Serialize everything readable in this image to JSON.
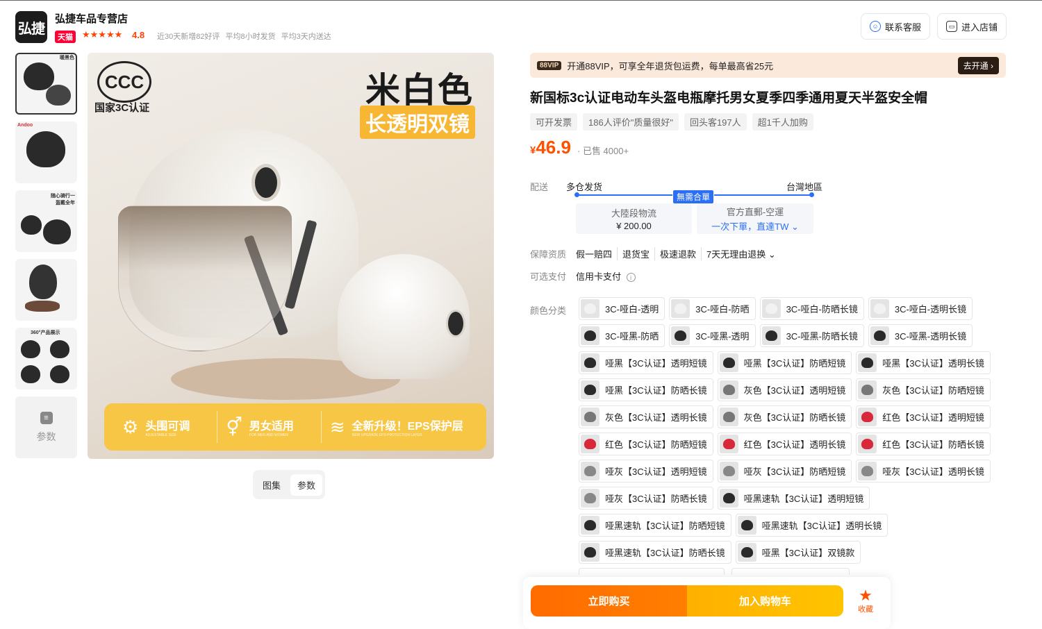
{
  "shop": {
    "logo_text": "弘捷",
    "name": "弘捷车品专营店",
    "badge": "天猫",
    "stars": "★★★★★",
    "rating": "4.8",
    "meta": [
      "近30天新增82好评",
      "平均8小时发货",
      "平均3天内送达"
    ],
    "buttons": {
      "service": "联系客服",
      "enter": "进入店铺"
    }
  },
  "gallery": {
    "thumb_labels": [
      "暖黑色",
      "Andoo",
      "随心骑行一盔戴全年",
      "",
      "360°产品展示"
    ],
    "params_thumb": "参数",
    "main": {
      "cert_logo": "CCC",
      "cert_text": "国家3C认证",
      "headline": "米白色",
      "subhead": "长透明双镜",
      "features": [
        {
          "title": "头围可调",
          "sub": "ADJUSTABLE SIZE"
        },
        {
          "title": "男女适用",
          "sub": "FOR MEN AND WOMEN"
        },
        {
          "title": "全新升级！EPS保护层",
          "sub": "NEW UPGRADE EPS PROTECTION LAYER"
        }
      ]
    },
    "tabs": [
      "图集",
      "参数"
    ]
  },
  "vip": {
    "badge": "88VIP",
    "text": "开通88VIP，可享全年退货包运费，每单最高省25元",
    "action": "去开通 ›"
  },
  "product": {
    "title": "新国标3c认证电动车头盔电瓶摩托男女夏季四季通用夏天半盔安全帽",
    "tags": [
      "可开发票",
      "186人评价\"质量很好\"",
      "回头客197人",
      "超1千人加购"
    ],
    "currency": "¥",
    "price": "46.9",
    "sold": "· 已售 4000+"
  },
  "shipping": {
    "label": "配送",
    "from": "多仓发货",
    "to": "台灣地區",
    "badge": "無需合單",
    "boxes": [
      {
        "title": "大陸段物流",
        "value": "¥ 200.00"
      },
      {
        "title": "官方直郵-空運",
        "value": "一次下單，直達TW ⌄"
      }
    ]
  },
  "guarantee": {
    "label": "保障资质",
    "items": [
      "假一赔四",
      "退货宝",
      "极速退款",
      "7天无理由退换 ⌄"
    ]
  },
  "payment": {
    "label": "可选支付",
    "value": "信用卡支付",
    "info": "i"
  },
  "sku": {
    "label": "颜色分类",
    "rows": [
      [
        {
          "t": "3C-哑白-透明",
          "c": "#f2f2f2"
        },
        {
          "t": "3C-哑白-防晒",
          "c": "#f2f2f2"
        },
        {
          "t": "3C-哑白-防晒长镜",
          "c": "#f2f2f2"
        },
        {
          "t": "3C-哑白-透明长镜",
          "c": "#f2f2f2"
        }
      ],
      [
        {
          "t": "3C-哑黑-防晒",
          "c": "#2a2a2a"
        },
        {
          "t": "3C-哑黑-透明",
          "c": "#2a2a2a"
        },
        {
          "t": "3C-哑黑-防晒长镜",
          "c": "#2a2a2a"
        },
        {
          "t": "3C-哑黑-透明长镜",
          "c": "#2a2a2a"
        }
      ],
      [
        {
          "t": "哑黑【3C认证】透明短镜",
          "c": "#2a2a2a"
        },
        {
          "t": "哑黑【3C认证】防晒短镜",
          "c": "#2a2a2a"
        },
        {
          "t": "哑黑【3C认证】透明长镜",
          "c": "#2a2a2a"
        }
      ],
      [
        {
          "t": "哑黑【3C认证】防晒长镜",
          "c": "#2a2a2a"
        },
        {
          "t": "灰色【3C认证】透明短镜",
          "c": "#777"
        },
        {
          "t": "灰色【3C认证】防晒短镜",
          "c": "#777"
        }
      ],
      [
        {
          "t": "灰色【3C认证】透明长镜",
          "c": "#777"
        },
        {
          "t": "灰色【3C认证】防晒长镜",
          "c": "#777"
        },
        {
          "t": "红色【3C认证】透明短镜",
          "c": "#d8283a"
        }
      ],
      [
        {
          "t": "红色【3C认证】防晒短镜",
          "c": "#d8283a"
        },
        {
          "t": "红色【3C认证】透明长镜",
          "c": "#d8283a"
        },
        {
          "t": "红色【3C认证】防晒长镜",
          "c": "#d8283a"
        }
      ],
      [
        {
          "t": "哑灰【3C认证】透明短镜",
          "c": "#888"
        },
        {
          "t": "哑灰【3C认证】防晒短镜",
          "c": "#888"
        },
        {
          "t": "哑灰【3C认证】透明长镜",
          "c": "#888"
        }
      ],
      [
        {
          "t": "哑灰【3C认证】防晒长镜",
          "c": "#888"
        },
        {
          "t": "哑黑速轨【3C认证】透明短镜",
          "c": "#2a2a2a"
        }
      ],
      [
        {
          "t": "哑黑速轨【3C认证】防晒短镜",
          "c": "#2a2a2a"
        },
        {
          "t": "哑黑速轨【3C认证】透明长镜",
          "c": "#2a2a2a"
        }
      ],
      [
        {
          "t": "哑黑速轨【3C认证】防晒长镜",
          "c": "#2a2a2a"
        },
        {
          "t": "哑黑【3C认证】双镜款",
          "c": "#2a2a2a"
        }
      ]
    ]
  },
  "actions": {
    "buy": "立即购买",
    "cart": "加入购物车",
    "fav_icon": "★",
    "fav": "收藏"
  },
  "colors": {
    "accent": "#ff5000",
    "blue": "#2a6ff5",
    "tmall": "#ff0036",
    "banner": "#f7c645"
  }
}
